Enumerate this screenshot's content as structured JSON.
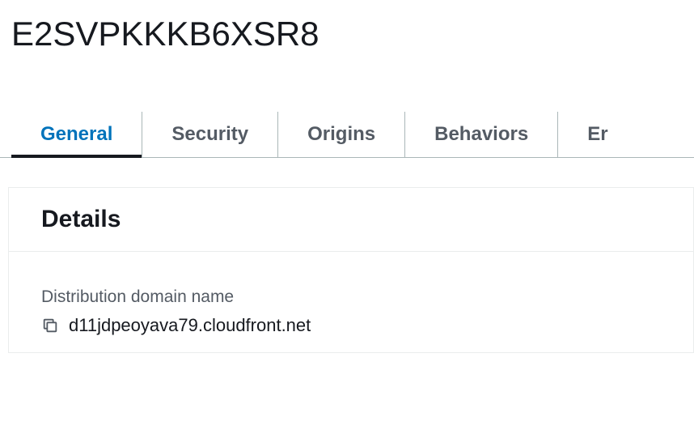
{
  "page": {
    "title": "E2SVPKKKB6XSR8"
  },
  "tabs": [
    {
      "label": "General",
      "active": true
    },
    {
      "label": "Security",
      "active": false
    },
    {
      "label": "Origins",
      "active": false
    },
    {
      "label": "Behaviors",
      "active": false
    },
    {
      "label": "Er",
      "active": false
    }
  ],
  "details": {
    "panel_title": "Details",
    "distribution_domain_name": {
      "label": "Distribution domain name",
      "value": "d11jdpeoyava79.cloudfront.net"
    }
  }
}
